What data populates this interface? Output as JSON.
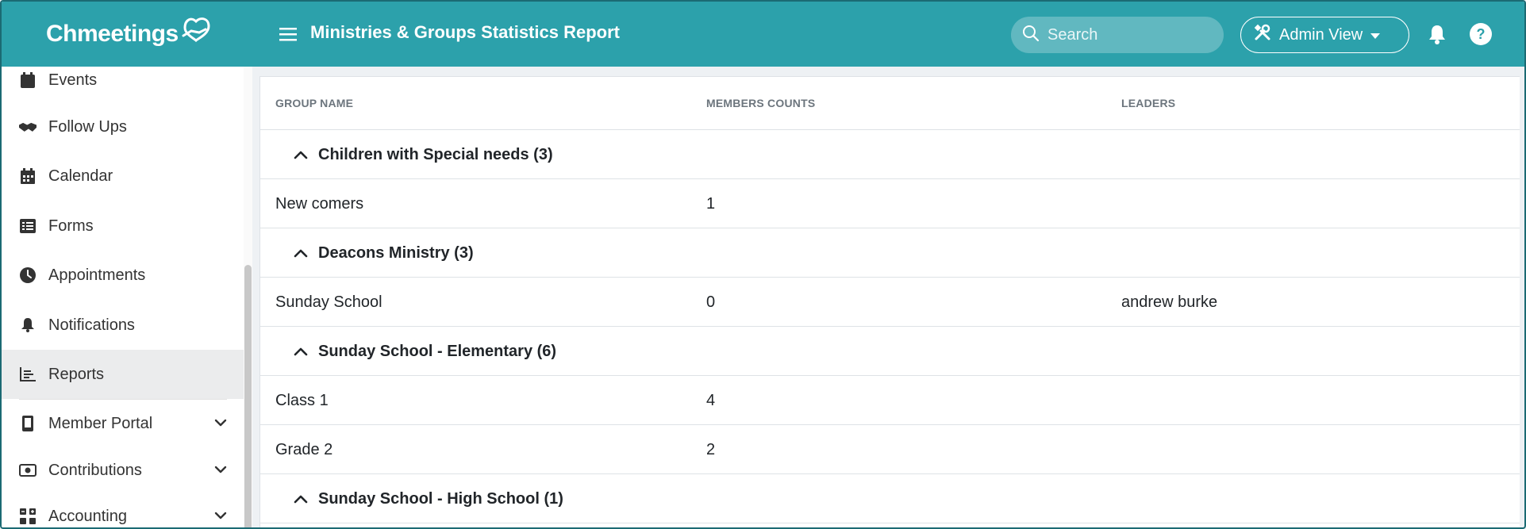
{
  "header": {
    "brand": "Chmeetings",
    "title": "Ministries & Groups Statistics Report",
    "search_placeholder": "Search",
    "admin_view_label": "Admin View",
    "accent_color": "#2ca1ab"
  },
  "sidebar": {
    "items": [
      {
        "label": "Events",
        "icon": "calendar-icon"
      },
      {
        "label": "Follow Ups",
        "icon": "handshake-icon"
      },
      {
        "label": "Calendar",
        "icon": "calendar-grid-icon"
      },
      {
        "label": "Forms",
        "icon": "list-form-icon"
      },
      {
        "label": "Appointments",
        "icon": "clock-icon"
      },
      {
        "label": "Notifications",
        "icon": "bell-icon"
      },
      {
        "label": "Reports",
        "icon": "chart-icon",
        "active": true
      },
      {
        "label": "Member Portal",
        "icon": "mobile-icon",
        "expandable": true
      },
      {
        "label": "Contributions",
        "icon": "money-icon",
        "expandable": true
      },
      {
        "label": "Accounting",
        "icon": "calculator-icon",
        "expandable": true
      }
    ]
  },
  "table": {
    "columns": [
      "GROUP NAME",
      "MEMBERS COUNTS",
      "LEADERS"
    ],
    "rows": [
      {
        "type": "group",
        "label": "Children with Special needs (3)"
      },
      {
        "type": "data",
        "name": "New comers",
        "count": "1",
        "leaders": ""
      },
      {
        "type": "group",
        "label": "Deacons Ministry (3)"
      },
      {
        "type": "data",
        "name": "Sunday School",
        "count": "0",
        "leaders": "andrew burke"
      },
      {
        "type": "group",
        "label": "Sunday School - Elementary (6)"
      },
      {
        "type": "data",
        "name": "Class 1",
        "count": "4",
        "leaders": ""
      },
      {
        "type": "data",
        "name": "Grade 2",
        "count": "2",
        "leaders": ""
      },
      {
        "type": "group",
        "label": "Sunday School - High School (1)"
      }
    ]
  }
}
